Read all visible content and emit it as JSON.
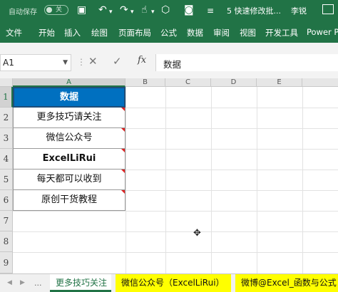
{
  "titlebar": {
    "autosave_label": "自动保存",
    "autosave_state": "关",
    "doc_title": "5 快速修改批...",
    "user": "李锐"
  },
  "ribbon_tabs": [
    "文件",
    "开始",
    "插入",
    "绘图",
    "页面布局",
    "公式",
    "数据",
    "审阅",
    "视图",
    "开发工具",
    "Power P"
  ],
  "formula_bar": {
    "name_box": "A1",
    "fx": "fx",
    "value": "数据"
  },
  "columns": [
    "A",
    "B",
    "C",
    "D",
    "E"
  ],
  "rows": [
    "1",
    "2",
    "3",
    "4",
    "5",
    "6",
    "7",
    "8",
    "9"
  ],
  "cells": [
    {
      "text": "数据",
      "style": "header"
    },
    {
      "text": "更多技巧请关注",
      "comment": true
    },
    {
      "text": "微信公众号",
      "comment": true
    },
    {
      "text": "ExcelLiRui",
      "comment": true,
      "style": "bold"
    },
    {
      "text": "每天都可以收到",
      "comment": true
    },
    {
      "text": "原创干货教程",
      "comment": true
    }
  ],
  "sheet_tabs": [
    "更多技巧关注",
    "微信公众号（ExcelLiRui）",
    "微博@Excel_函数与公式"
  ],
  "sheet_nav_more": "...",
  "colors": {
    "ribbon": "#217346",
    "header_fill": "#0070c0",
    "sheet_tab_highlight": "#ffff00",
    "comment_marker": "#e02020"
  }
}
